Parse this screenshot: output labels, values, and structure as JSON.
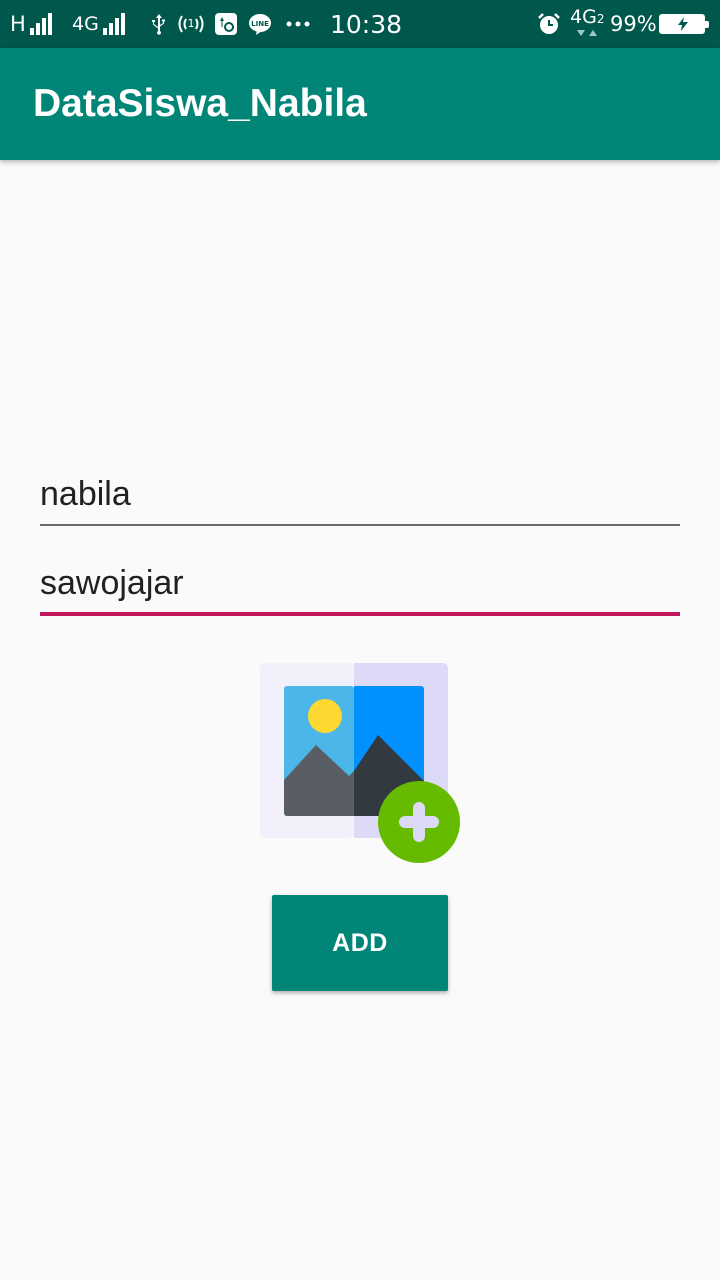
{
  "status_bar": {
    "network_1": "H",
    "network_2": "4G",
    "time": "10:38",
    "network_3": "4G",
    "sim_index": "2",
    "battery_percent": "99%",
    "icons": [
      "signal-icon",
      "usb-icon",
      "hotspot-icon",
      "settings-notification-icon",
      "line-app-icon",
      "more-dots-icon",
      "alarm-icon",
      "battery-charging-icon"
    ]
  },
  "app_bar": {
    "title": "DataSiswa_Nabila",
    "color": "#008577"
  },
  "form": {
    "name_value": "nabila",
    "address_value": "sawojajar",
    "focused_underline_color": "#c2185b"
  },
  "image_picker": {
    "icon": "add-image-icon"
  },
  "add_button": {
    "label": "ADD"
  }
}
